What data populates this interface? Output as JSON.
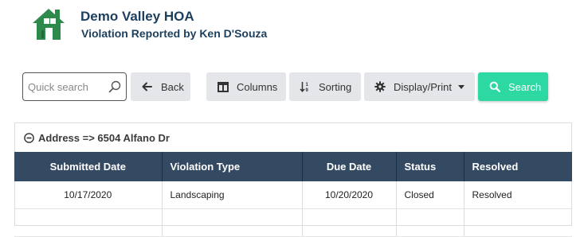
{
  "header": {
    "title": "Demo Valley HOA",
    "subtitle": "Violation Reported by Ken D'Souza",
    "logo_icon": "house-icon",
    "brand_color": "#2e8a4c"
  },
  "toolbar": {
    "search_placeholder": "Quick search",
    "back_label": "Back",
    "columns_label": "Columns",
    "sorting_label": "Sorting",
    "display_label": "Display/Print",
    "search_label": "Search",
    "search_color": "#2ed8a3"
  },
  "group": {
    "label": "Address => 6504 Alfano Dr",
    "icon": "minus-circle-icon"
  },
  "table": {
    "columns": [
      "Submitted Date",
      "Violation Type",
      "Due Date",
      "Status",
      "Resolved"
    ],
    "header_color": "#344a62",
    "rows": [
      [
        "10/17/2020",
        "Landscaping",
        "10/20/2020",
        "Closed",
        "Resolved"
      ]
    ]
  }
}
